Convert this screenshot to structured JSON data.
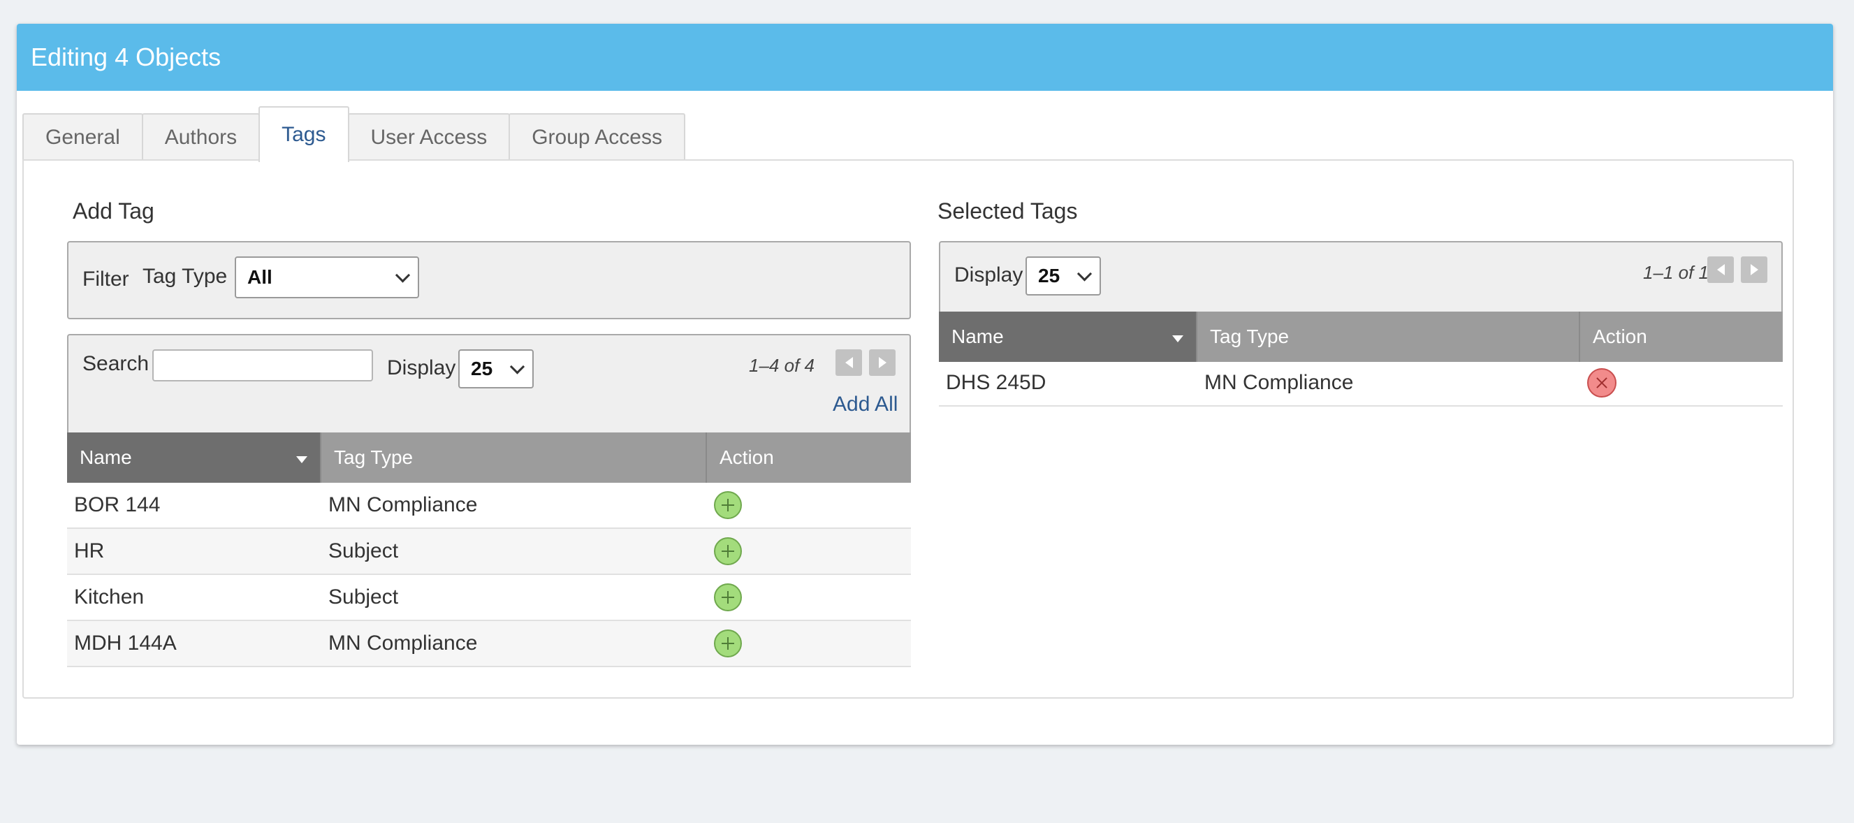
{
  "dialog": {
    "title": "Editing 4 Objects"
  },
  "tabs": [
    {
      "label": "General"
    },
    {
      "label": "Authors"
    },
    {
      "label": "Tags"
    },
    {
      "label": "User Access"
    },
    {
      "label": "Group Access"
    }
  ],
  "add_tag": {
    "title": "Add Tag",
    "filter": {
      "label": "Filter",
      "tag_type_label": "Tag Type",
      "tag_type_value": "All"
    },
    "search_label": "Search",
    "search_value": "",
    "display_label": "Display",
    "display_value": "25",
    "pager_text": "1–4 of 4",
    "add_all_label": "Add All",
    "columns": [
      "Name",
      "Tag Type",
      "Action"
    ],
    "rows": [
      {
        "name": "BOR 144",
        "tag_type": "MN Compliance"
      },
      {
        "name": "HR",
        "tag_type": "Subject"
      },
      {
        "name": "Kitchen",
        "tag_type": "Subject"
      },
      {
        "name": "MDH 144A",
        "tag_type": "MN Compliance"
      }
    ]
  },
  "selected_tags": {
    "title": "Selected Tags",
    "display_label": "Display",
    "display_value": "25",
    "pager_text": "1–1 of 1",
    "columns": [
      "Name",
      "Tag Type",
      "Action"
    ],
    "rows": [
      {
        "name": "DHS 245D",
        "tag_type": "MN Compliance"
      }
    ]
  },
  "colors": {
    "header": "#5bbbea",
    "active_tab_text": "#2d5a90",
    "add_icon": "#a3dc7c",
    "remove_icon": "#f28b8b"
  }
}
